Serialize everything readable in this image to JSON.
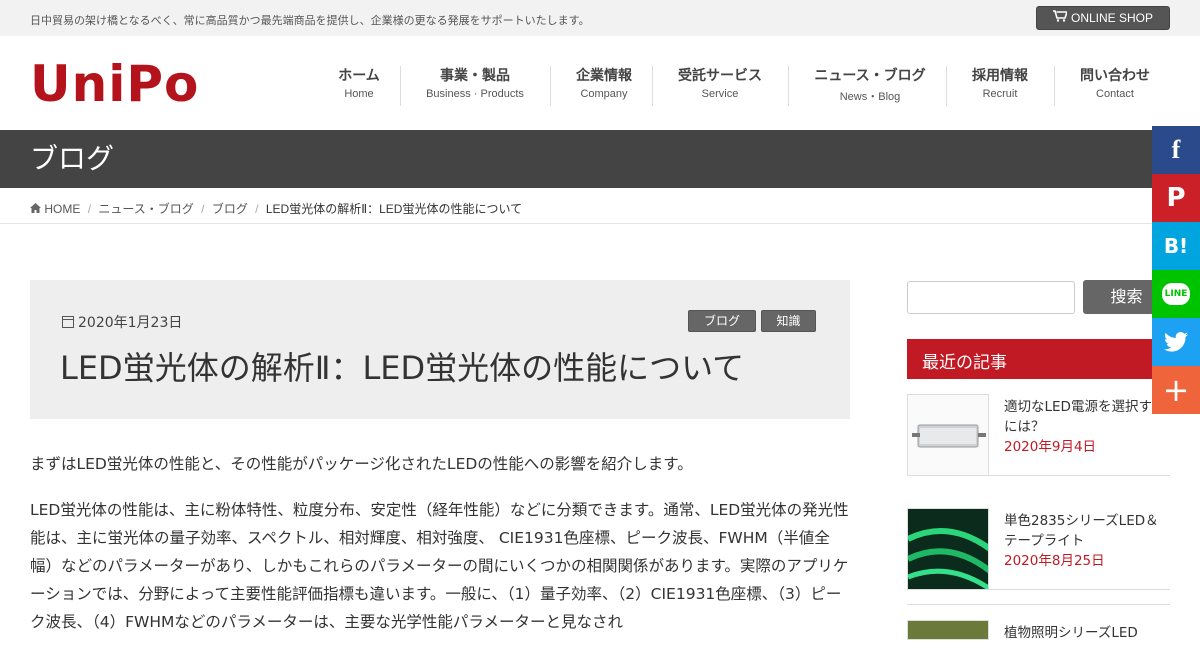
{
  "topbar": {
    "tagline": "日中貿易の架け橋となるべく、常に高品質かつ最先端商品を提供し、企業様の更なる発展をサポートいたします。",
    "shop_label": "ONLINE SHOP",
    "shop_icon": "cart-icon"
  },
  "logo": {
    "text": "UniPo",
    "color": "#b5131b"
  },
  "nav": [
    {
      "jp": "ホーム",
      "en": "Home"
    },
    {
      "jp": "事業・製品",
      "en": "Business · Products"
    },
    {
      "jp": "企業情報",
      "en": "Company"
    },
    {
      "jp": "受託サービス",
      "en": "Service"
    },
    {
      "jp": "ニュース・ブログ",
      "en": "News・Blog"
    },
    {
      "jp": "採用情報",
      "en": "Recruit"
    },
    {
      "jp": "問い合わせ",
      "en": "Contact"
    }
  ],
  "page_title": "ブログ",
  "breadcrumb": {
    "home": "HOME",
    "items": [
      "ニュース・ブログ",
      "ブログ"
    ],
    "current": "LED蛍光体の解析Ⅱ：LED蛍光体の性能について"
  },
  "article": {
    "date": "2020年1月23日",
    "tags": [
      "ブログ",
      "知識"
    ],
    "title": "LED蛍光体の解析Ⅱ：LED蛍光体の性能について",
    "paragraphs": [
      "まずはLED蛍光体の性能と、その性能がパッケージ化されたLEDの性能への影響を紹介します。",
      "LED蛍光体の性能は、主に粉体特性、粒度分布、安定性（経年性能）などに分類できます。通常、LED蛍光体の発光性能は、主に蛍光体の量子効率、スペクトル、相対輝度、相対強度、 CIE1931色座標、ピーク波長、FWHM（半値全幅）などのパラメーターがあり、しかもこれらのパラメーターの間にいくつかの相関関係があります。実際のアプリケーションでは、分野によって主要性能評価指標も違います。一般に、（1）量子効率、（2）CIE1931色座標、（3）ピーク波長、（4）FWHMなどのパラメーターは、主要な光学性能パラメーターと見なされ"
    ]
  },
  "sidebar": {
    "search_button": "搜索",
    "search_placeholder": "",
    "recent_heading": "最近の記事",
    "posts": [
      {
        "title": "適切なLED電源を選択するには？",
        "date": "2020年9月4日"
      },
      {
        "title": "単色2835シリーズLED＆テープライト",
        "date": "2020年8月25日"
      },
      {
        "title": "植物照明シリーズLED",
        "date": ""
      }
    ]
  },
  "share": [
    {
      "icon": "facebook-icon",
      "glyph": "f",
      "color": "#2b4a8b"
    },
    {
      "icon": "pinterest-icon",
      "glyph": "P",
      "color": "#cb2027"
    },
    {
      "icon": "hatena-icon",
      "glyph": "B!",
      "color": "#00a4de"
    },
    {
      "icon": "line-icon",
      "glyph": "LINE",
      "color": "#00c300"
    },
    {
      "icon": "twitter-icon",
      "glyph": "t",
      "color": "#1da1f2"
    },
    {
      "icon": "more-icon",
      "glyph": "+",
      "color": "#f0643c"
    }
  ]
}
